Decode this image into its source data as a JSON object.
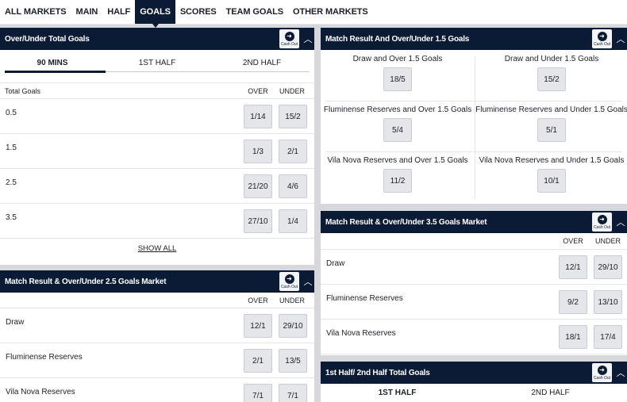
{
  "nav": {
    "tabs": [
      "ALL MARKETS",
      "MAIN",
      "HALF",
      "GOALS",
      "SCORES",
      "TEAM GOALS",
      "OTHER MARKETS"
    ],
    "active": "GOALS"
  },
  "cashout_label": "Cash Out",
  "ou_total": {
    "title": "Over/Under Total Goals",
    "subtabs": [
      "90 MINS",
      "1ST HALF",
      "2ND HALF"
    ],
    "col_label": "Total Goals",
    "over_label": "OVER",
    "under_label": "UNDER",
    "rows": [
      {
        "label": "0.5",
        "over": "1/14",
        "under": "15/2"
      },
      {
        "label": "1.5",
        "over": "1/3",
        "under": "2/1"
      },
      {
        "label": "2.5",
        "over": "21/20",
        "under": "4/6"
      },
      {
        "label": "3.5",
        "over": "27/10",
        "under": "1/4"
      }
    ],
    "show_all": "SHOW ALL"
  },
  "mr_ou25": {
    "title": "Match Result & Over/Under 2.5 Goals Market",
    "over_label": "OVER",
    "under_label": "UNDER",
    "rows": [
      {
        "label": "Draw",
        "over": "12/1",
        "under": "29/10"
      },
      {
        "label": "Fluminense Reserves",
        "over": "2/1",
        "under": "13/5"
      },
      {
        "label": "Vila Nova Reserves",
        "over": "7/1",
        "under": "7/1"
      }
    ]
  },
  "mr_ou15": {
    "title": "Match Result And Over/Under 1.5 Goals",
    "cells": [
      {
        "name": "Draw and Over 1.5 Goals",
        "odds": "18/5"
      },
      {
        "name": "Draw and Under 1.5 Goals",
        "odds": "15/2"
      },
      {
        "name": "Fluminense Reserves and Over 1.5 Goals",
        "odds": "5/4"
      },
      {
        "name": "Fluminense Reserves and Under 1.5 Goals",
        "odds": "5/1"
      },
      {
        "name": "Vila Nova Reserves and Over 1.5 Goals",
        "odds": "11/2"
      },
      {
        "name": "Vila Nova Reserves and Under 1.5 Goals",
        "odds": "10/1"
      }
    ]
  },
  "mr_ou35": {
    "title": "Match Result & Over/Under 3.5 Goals Market",
    "over_label": "OVER",
    "under_label": "UNDER",
    "rows": [
      {
        "label": "Draw",
        "over": "12/1",
        "under": "29/10"
      },
      {
        "label": "Fluminense Reserves",
        "over": "9/2",
        "under": "13/10"
      },
      {
        "label": "Vila Nova Reserves",
        "over": "18/1",
        "under": "17/4"
      }
    ]
  },
  "half_total": {
    "title": "1st Half/ 2nd Half Total Goals",
    "subtabs": [
      "1ST HALF",
      "2ND HALF"
    ]
  }
}
